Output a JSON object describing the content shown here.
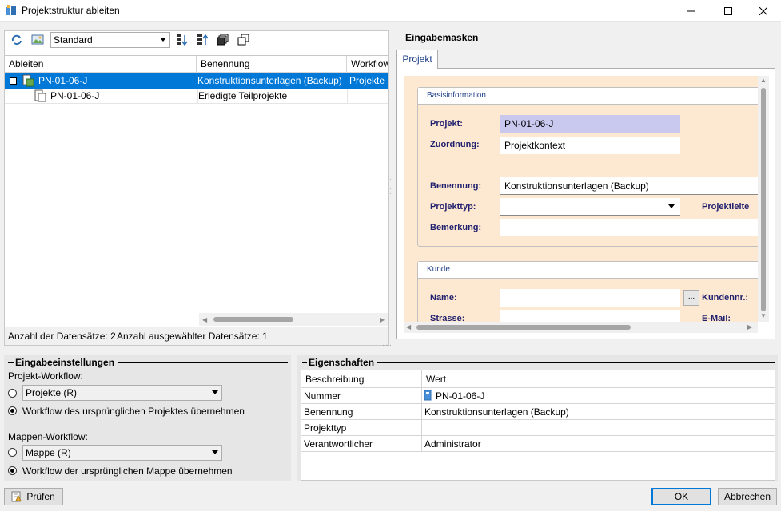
{
  "window": {
    "title": "Projektstruktur ableiten"
  },
  "toolbar": {
    "view_select": "Standard"
  },
  "grid": {
    "columns": [
      "Ableiten",
      "Benennung",
      "Workflow"
    ],
    "rows": [
      {
        "id": "PN-01-06-J",
        "benennung": "Konstruktionsunterlagen (Backup)",
        "workflow": "Projekte (R)",
        "selected": true
      },
      {
        "id": "PN-01-06-J",
        "benennung": "Erledigte Teilprojekte",
        "workflow": "",
        "selected": false
      }
    ]
  },
  "status": {
    "count": "Anzahl der Datensätze: 2",
    "selected": "Anzahl ausgewählter Datensätze: 1"
  },
  "masks": {
    "title": "Eingabemasken",
    "tab": "Projekt",
    "basis": {
      "title": "Basisinformation",
      "projekt_label": "Projekt:",
      "projekt_value": "PN-01-06-J",
      "zuordnung_label": "Zuordnung:",
      "zuordnung_value": "Projektkontext",
      "benennung_label": "Benennung:",
      "benennung_value": "Konstruktionsunterlagen (Backup)",
      "projekttyp_label": "Projekttyp:",
      "projektleiter_label": "Projektleite",
      "bemerkung_label": "Bemerkung:"
    },
    "kunde": {
      "title": "Kunde",
      "name_label": "Name:",
      "kundennr_label": "Kundennr.:",
      "strasse_label": "Strasse:",
      "email_label": "E-Mail:",
      "browse": "..."
    }
  },
  "settings": {
    "title": "Eingabeeinstellungen",
    "projekt_workflow_label": "Projekt-Workflow:",
    "projekt_workflow_value": "Projekte (R)",
    "projekt_radio2": "Workflow des ursprünglichen Projektes übernehmen",
    "mappen_workflow_label": "Mappen-Workflow:",
    "mappen_workflow_value": "Mappe (R)",
    "mappen_radio2": "Workflow der ursprünglichen Mappe übernehmen"
  },
  "properties": {
    "title": "Eigenschaften",
    "col_desc": "Beschreibung",
    "col_value": "Wert",
    "rows": [
      {
        "name": "Nummer",
        "value": "PN-01-06-J"
      },
      {
        "name": "Benennung",
        "value": "Konstruktionsunterlagen (Backup)"
      },
      {
        "name": "Projekttyp",
        "value": ""
      },
      {
        "name": "Verantwortlicher",
        "value": "Administrator"
      }
    ]
  },
  "buttons": {
    "pruefen": "Prüfen",
    "ok": "OK",
    "abbrechen": "Abbrechen"
  }
}
